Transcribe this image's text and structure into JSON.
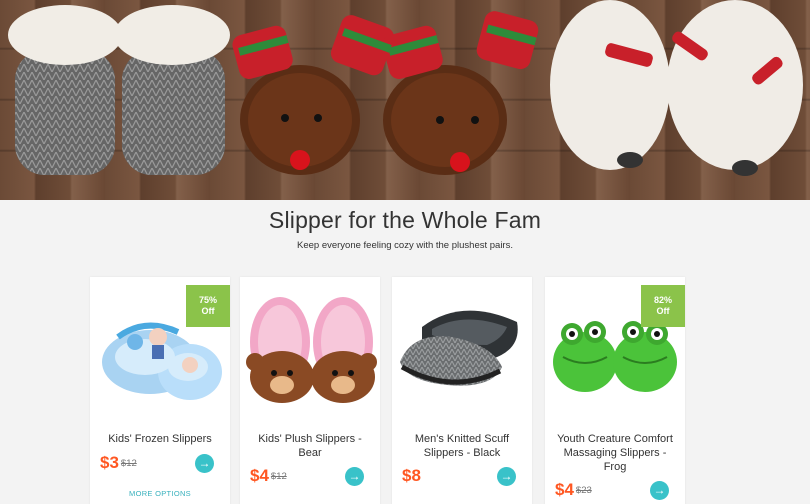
{
  "banner": {
    "icon": "slipper-photo"
  },
  "section": {
    "title": "Slipper for the Whole Fam",
    "subtitle": "Keep everyone feeling cozy with the plushest pairs."
  },
  "products": [
    {
      "name": "Kids' Frozen Slippers",
      "price": "$3",
      "old_price": "$12",
      "badge_pct": "75%",
      "badge_off": "Off",
      "more": "MORE OPTIONS"
    },
    {
      "name": "Kids' Plush Slippers - Bear",
      "price": "$4",
      "old_price": "$12"
    },
    {
      "name": "Men's Knitted Scuff Slippers - Black",
      "price": "$8"
    },
    {
      "name": "Youth Creature Comfort Massaging Slippers - Frog",
      "price": "$4",
      "old_price": "$23",
      "badge_pct": "82%",
      "badge_off": "Off"
    }
  ],
  "colors": {
    "accent": "#39c2c9",
    "price": "#ff5722",
    "badge": "#8bc34a"
  }
}
